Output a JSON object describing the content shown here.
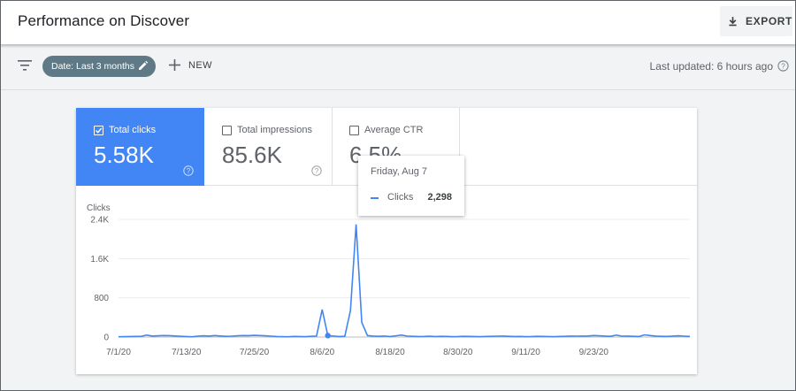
{
  "header": {
    "title": "Performance on Discover",
    "export_label": "EXPORT"
  },
  "toolbar": {
    "date_filter_label": "Date: Last 3 months",
    "new_label": "NEW",
    "last_updated": "Last updated: 6 hours ago"
  },
  "metrics": [
    {
      "label": "Total clicks",
      "value": "5.58K",
      "checked": true
    },
    {
      "label": "Total impressions",
      "value": "85.6K",
      "checked": false
    },
    {
      "label": "Average CTR",
      "value": "6.5%",
      "checked": false
    }
  ],
  "tooltip": {
    "date": "Friday, Aug 7",
    "series": "Clicks",
    "value": "2,298"
  },
  "colors": {
    "accent": "#4285f4",
    "chip": "#5f7a86"
  },
  "chart_data": {
    "type": "line",
    "ylabel": "Clicks",
    "ylim": [
      0,
      2400
    ],
    "yticks": [
      "0",
      "800",
      "1.6K",
      "2.4K"
    ],
    "xticks": [
      "7/1/20",
      "7/13/20",
      "7/25/20",
      "8/6/20",
      "8/18/20",
      "8/30/20",
      "9/11/20",
      "9/23/20"
    ],
    "start_date": "2020-07-01",
    "series": [
      {
        "name": "Clicks",
        "values": [
          5,
          8,
          10,
          12,
          15,
          40,
          20,
          25,
          30,
          28,
          22,
          15,
          10,
          5,
          18,
          25,
          20,
          30,
          22,
          15,
          18,
          25,
          30,
          28,
          35,
          30,
          25,
          18,
          10,
          8,
          5,
          12,
          10,
          8,
          15,
          20,
          560,
          30,
          20,
          10,
          15,
          540,
          2298,
          300,
          30,
          20,
          15,
          20,
          10,
          25,
          40,
          20,
          15,
          10,
          12,
          18,
          10,
          15,
          12,
          8,
          10,
          15,
          12,
          10,
          8,
          12,
          15,
          18,
          20,
          15,
          10,
          12,
          8,
          10,
          15,
          12,
          10,
          8,
          12,
          15,
          20,
          18,
          20,
          22,
          30,
          25,
          20,
          15,
          40,
          18,
          20,
          15,
          10,
          45,
          30,
          20,
          15,
          12,
          20,
          25,
          18,
          12
        ]
      }
    ],
    "highlight_index": 37
  }
}
